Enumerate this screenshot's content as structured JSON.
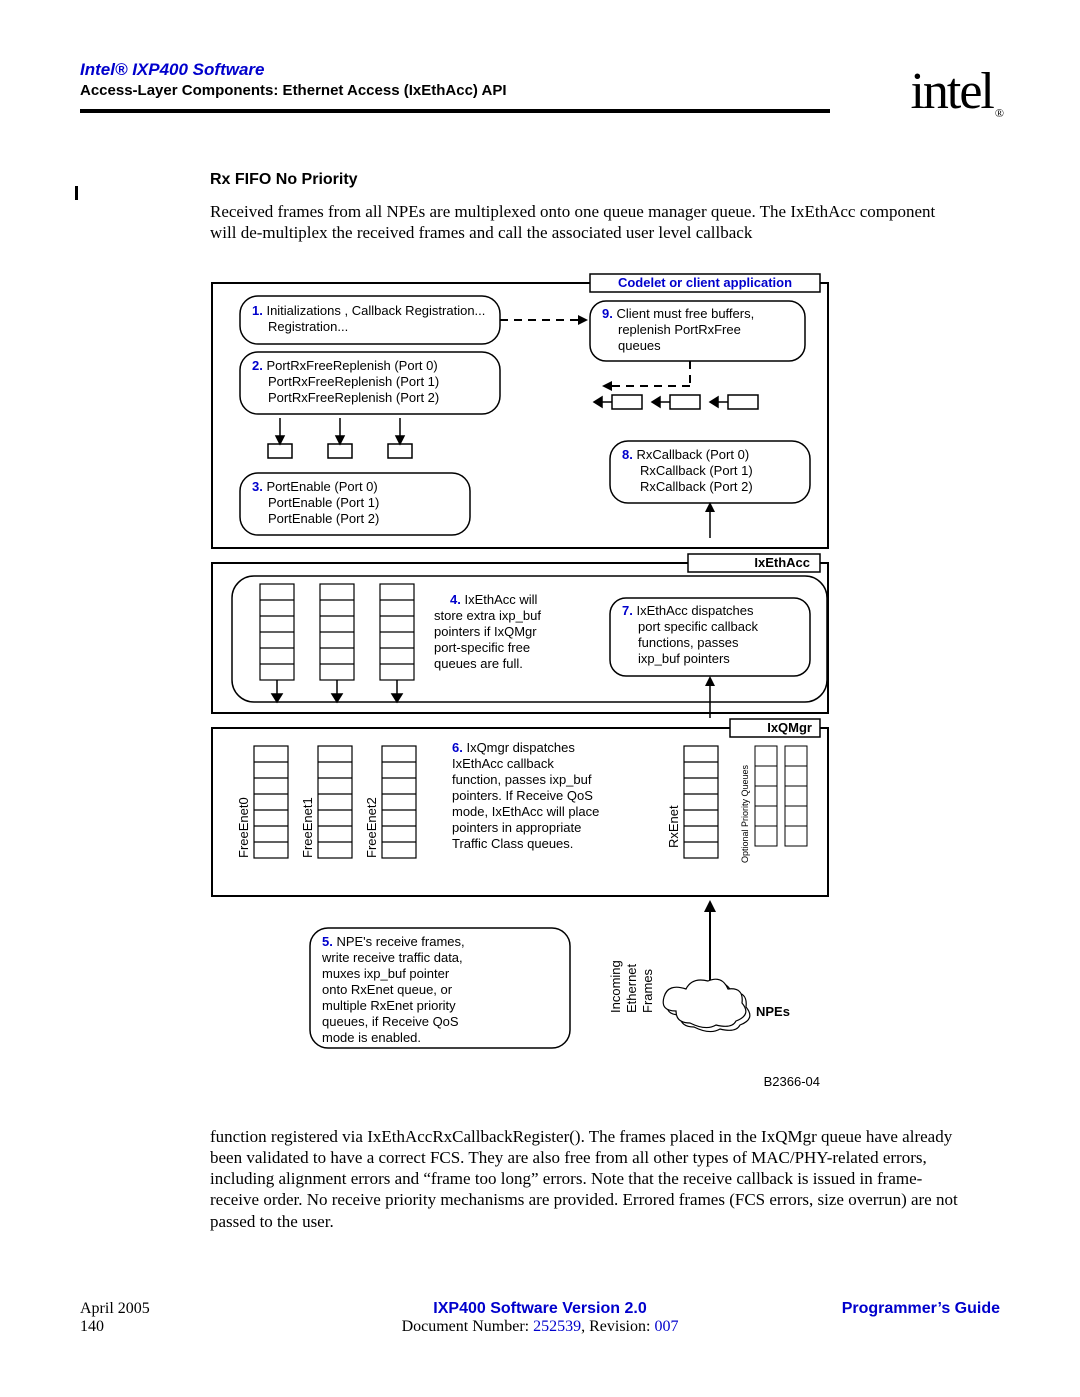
{
  "header": {
    "product_title": "Intel® IXP400 Software",
    "chapter": "Access-Layer Components: Ethernet Access (IxEthAcc) API",
    "logo_text": "intel",
    "logo_reg": "®"
  },
  "section": {
    "title": "Rx FIFO No Priority",
    "para_before_figure": "Received frames from all NPEs are multiplexed onto one queue manager queue. The IxEthAcc component will de-multiplex the received frames and call the associated user level callback",
    "para_after_figure": "function registered via IxEthAccRxCallbackRegister(). The frames placed in the IxQMgr queue have already been validated to have a correct FCS. They are also free from all other types of MAC/PHY-related errors, including alignment errors and “frame too long” errors. Note that the receive callback is issued in frame-receive order. No receive priority mechanisms are provided. Errored frames (FCS errors, size overrun) are not passed to the user."
  },
  "diagram": {
    "header_box": "Codelet or client application",
    "box1_num": "1.",
    "box1_text": " Initializations , Callback Registration...",
    "box2_num": "2.",
    "box2_lines": [
      "  PortRxFreeReplenish (Port 0)",
      "PortRxFreeReplenish (Port 1)",
      "PortRxFreeReplenish (Port 2)"
    ],
    "box3_num": "3.",
    "box3_lines": [
      " PortEnable (Port 0)",
      "PortEnable (Port 1)",
      "PortEnable (Port 2)"
    ],
    "box9_num": "9.",
    "box9_text": " Client must free buffers, replenish PortRxFree queues",
    "box8_num": "8.",
    "box8_lines": [
      "   RxCallback (Port 0)",
      "RxCallback (Port 1)",
      "RxCallback (Port 2)"
    ],
    "ixethacc_label": "IxEthAcc",
    "box4_num": "4.",
    "box4_text": " IxEthAcc will store extra ixp_buf pointers if IxQMgr port-specific free queues are full.",
    "box7_num": "7.",
    "box7_text": " IxEthAcc dispatches port specific callback functions, passes ixp_buf pointers",
    "ixqmgr_label": "IxQMgr",
    "free_enet": [
      "FreeEnet0",
      "FreeEnet1",
      "FreeEnet2"
    ],
    "rx_enet": "RxEnet",
    "opt_queues": "Optional Priority Queues",
    "box6_num": "6.",
    "box6_text": " IxQmgr dispatches IxEthAcc callback function, passes ixp_buf pointers. If Receive QoS mode, IxEthAcc will place pointers in appropriate Traffic Class queues.",
    "box5_num": "5.",
    "box5_text": " NPE's receive frames, write receive traffic data, muxes ixp_buf pointer onto RxEnet queue, or multiple RxEnet priority queues, if Receive QoS mode is enabled.",
    "incoming_label": "Incoming Ethernet Frames",
    "npes_label": "NPEs",
    "fig_id": "B2366-04"
  },
  "footer": {
    "date": "April 2005",
    "page": "140",
    "version": "IXP400 Software Version 2.0",
    "doc_prefix": "Document Number: ",
    "doc_num": "252539",
    "rev_prefix": ", Revision: ",
    "rev_num": "007",
    "guide": "Programmer’s Guide"
  }
}
